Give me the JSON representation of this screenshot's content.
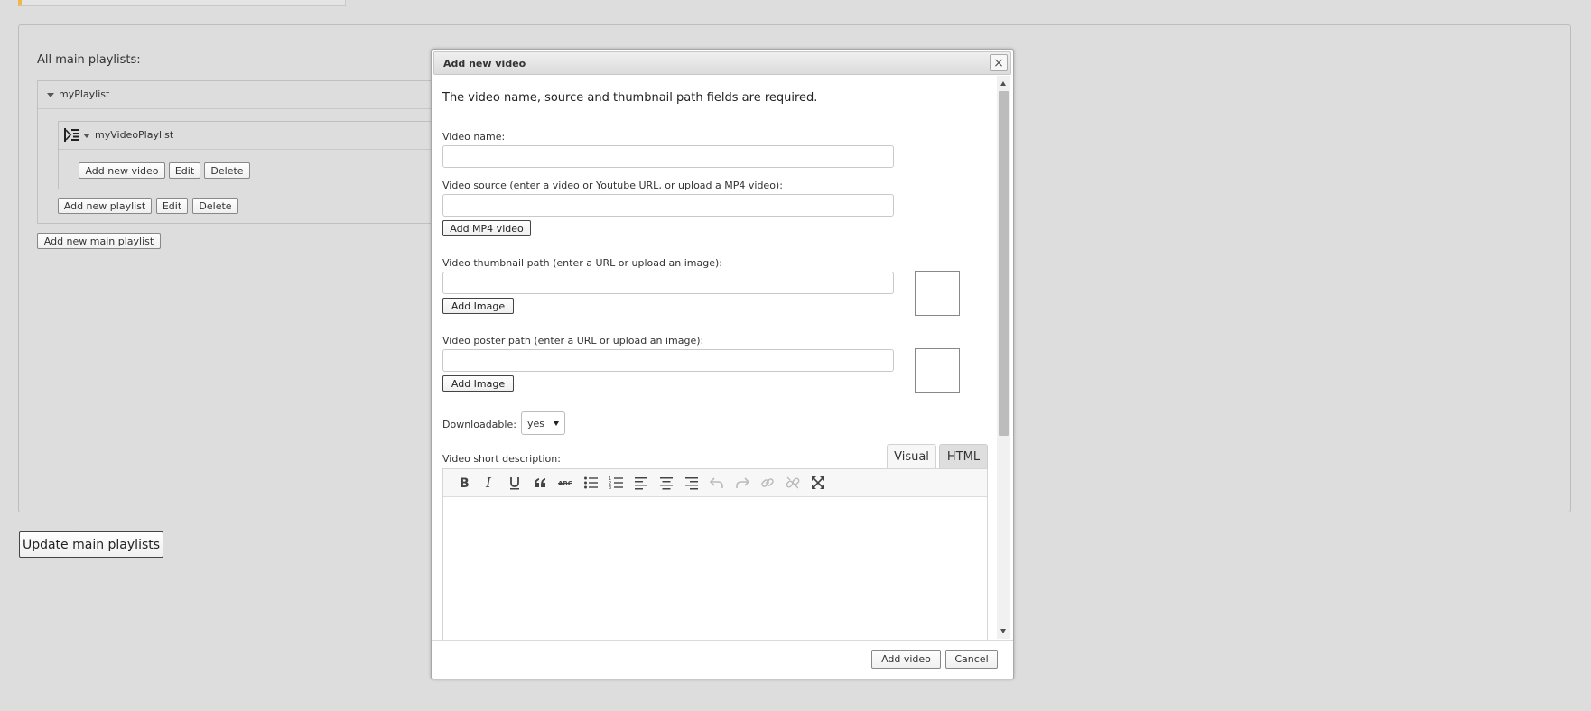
{
  "background_page": {
    "all_main_playlists_label": "All main playlists:",
    "main_playlist": {
      "name": "myPlaylist"
    },
    "video_playlist": {
      "name": "myVideoPlaylist"
    },
    "video_playlist_buttons": {
      "add_new_video": "Add new video",
      "edit": "Edit",
      "delete": "Delete"
    },
    "playlist_buttons": {
      "add_new_playlist": "Add new playlist",
      "edit": "Edit",
      "delete": "Delete"
    },
    "add_new_main_playlist": "Add new main playlist",
    "update_main_playlists": "Update main playlists"
  },
  "dialog": {
    "title": "Add new video",
    "close_label": "×",
    "required_note": "The video name, source and thumbnail path fields are required.",
    "video_name": {
      "label": "Video name:",
      "value": ""
    },
    "video_source": {
      "label": "Video source (enter a video or Youtube URL, or upload a MP4 video):",
      "value": "",
      "button": "Add MP4 video"
    },
    "video_thumbnail": {
      "label": "Video thumbnail path (enter a URL or upload an image):",
      "value": "",
      "button": "Add Image"
    },
    "video_poster": {
      "label": "Video poster path (enter a URL or upload an image):",
      "value": "",
      "button": "Add Image"
    },
    "downloadable": {
      "label": "Downloadable:",
      "selected": "yes"
    },
    "short_description": {
      "label": "Video short description:",
      "tabs": {
        "visual": "Visual",
        "html": "HTML"
      },
      "active_tab": "visual",
      "toolbar_icons": [
        "bold-icon",
        "italic-icon",
        "underline-icon",
        "blockquote-icon",
        "strikethrough-icon",
        "bullet-list-icon",
        "numbered-list-icon",
        "align-left-icon",
        "align-center-icon",
        "align-right-icon",
        "undo-icon",
        "redo-icon",
        "link-icon",
        "unlink-icon",
        "fullscreen-icon"
      ],
      "content": ""
    },
    "footer": {
      "add_video": "Add video",
      "cancel": "Cancel"
    }
  },
  "colors": {
    "page_background": "#dddddd",
    "accent_bar": "#f0b849",
    "dialog_titlebar": "#e6e6e6",
    "scrollbar_thumb": "#bcbcbc"
  }
}
